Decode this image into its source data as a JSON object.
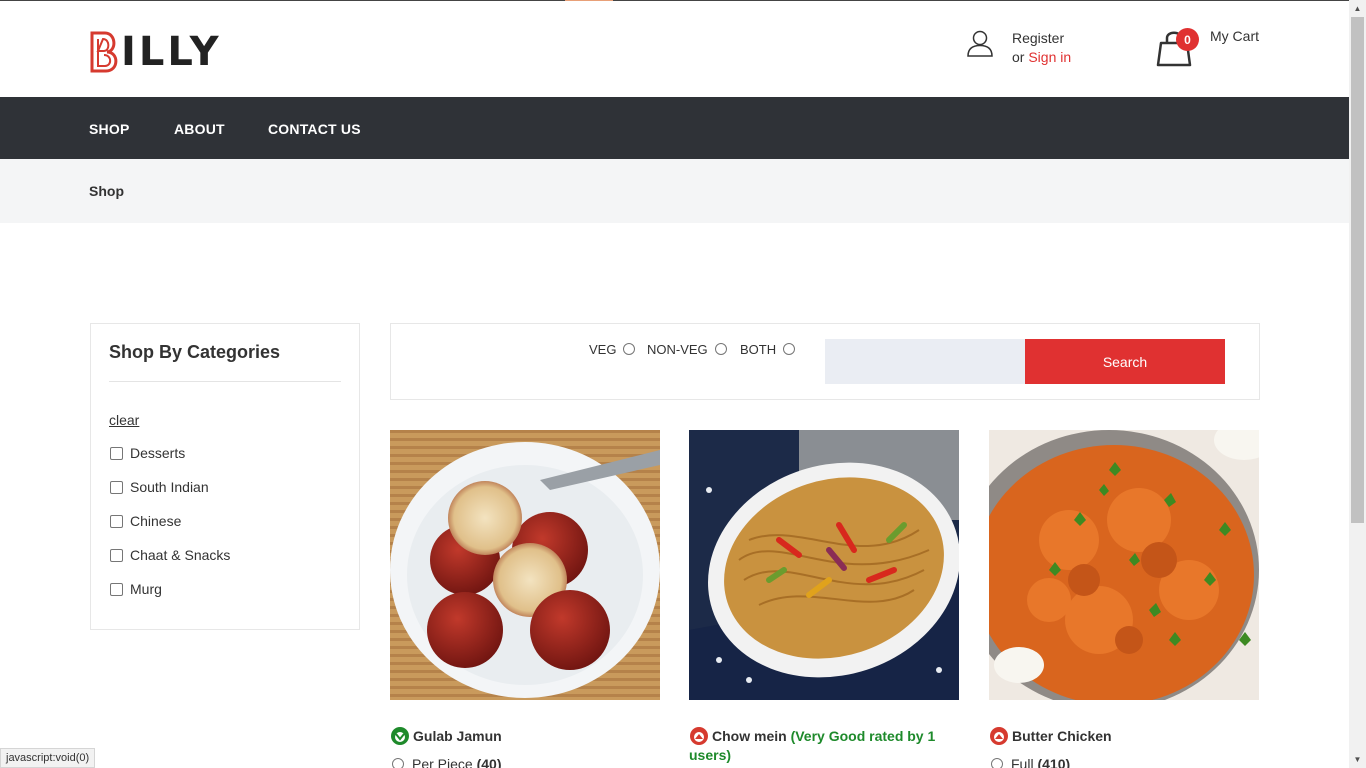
{
  "brand": {
    "logo_text": "ILLY",
    "logo_mark": "B"
  },
  "header": {
    "register_label": "Register",
    "or_label": "or ",
    "signin_label": "Sign in",
    "cart_count": "0",
    "cart_label": "My Cart"
  },
  "nav": {
    "items": [
      "SHOP",
      "ABOUT",
      "CONTACT US"
    ]
  },
  "breadcrumb": {
    "current": "Shop"
  },
  "sidebar": {
    "title": "Shop By Categories",
    "clear_label": "clear",
    "categories": [
      "Desserts",
      "South Indian",
      "Chinese",
      "Chaat & Snacks",
      "Murg"
    ]
  },
  "filters": {
    "options": [
      "VEG",
      "NON-VEG",
      "BOTH"
    ],
    "search_value": "",
    "search_button": "Search"
  },
  "products": [
    {
      "name": "Gulab Jamun",
      "type": "veg",
      "rating_text": "",
      "variant_label": "Per Piece",
      "variant_price": "(40)"
    },
    {
      "name": "Chow mein",
      "type": "non-veg",
      "rating_text": "(Very Good rated by 1 users)",
      "variant_label": "",
      "variant_price": ""
    },
    {
      "name": "Butter Chicken",
      "type": "non-veg",
      "rating_text": "",
      "variant_label": "Full",
      "variant_price": "(410)"
    }
  ],
  "status_bar": {
    "text": "javascript:void(0)"
  },
  "colors": {
    "accent": "#e03131",
    "nav_bg": "#2f3237",
    "veg": "#1e8a2b",
    "nonveg": "#d63a2f"
  }
}
